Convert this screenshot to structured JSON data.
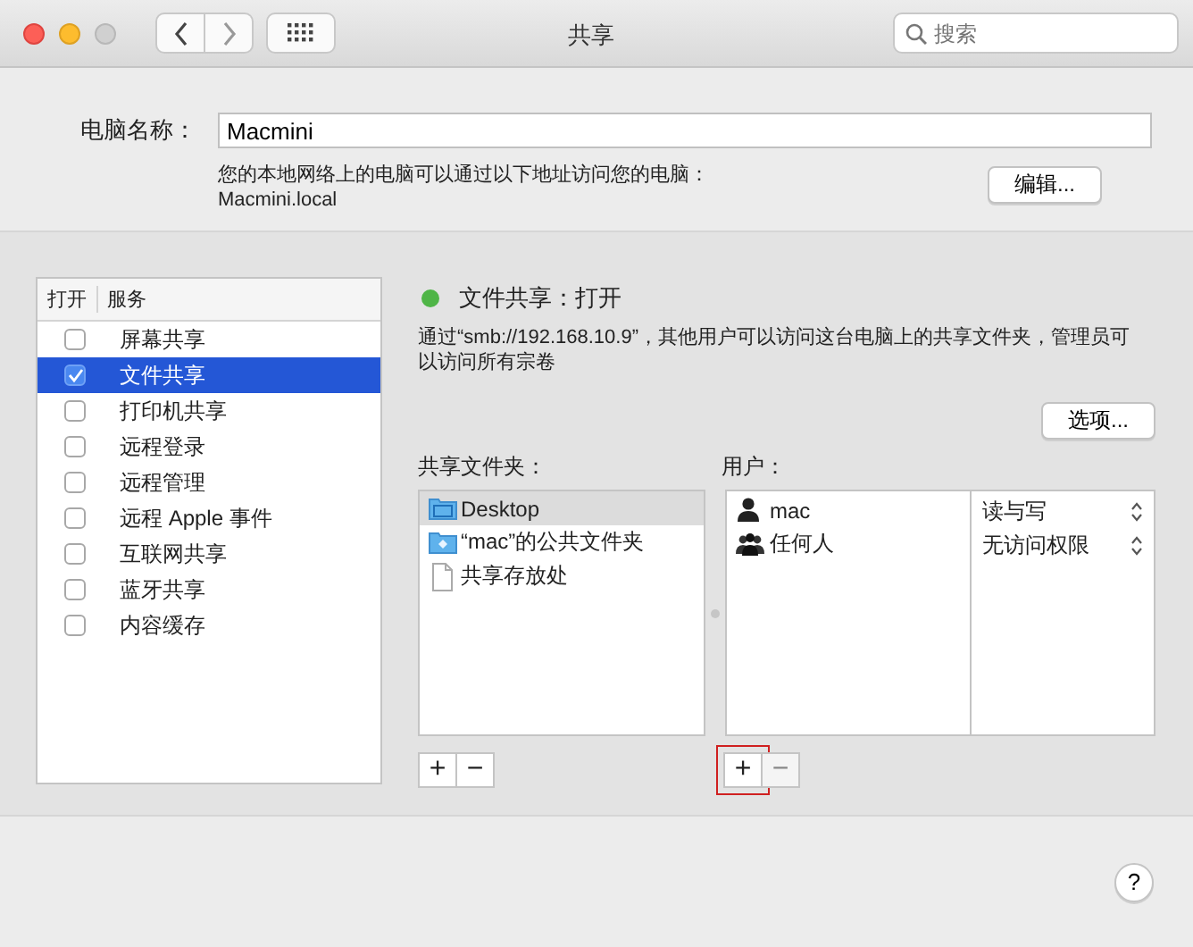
{
  "window": {
    "title": "共享",
    "search": {
      "placeholder": "搜索"
    }
  },
  "computer_name": {
    "label": "电脑名称：",
    "value": "Macmini",
    "hint": "您的本地网络上的电脑可以通过以下地址访问您的电脑：",
    "address": "Macmini.local",
    "edit_button": "编辑..."
  },
  "services": {
    "columns": [
      "打开",
      "服务"
    ],
    "items": [
      {
        "name": "屏幕共享",
        "checked": false,
        "selected": false
      },
      {
        "name": "文件共享",
        "checked": true,
        "selected": true
      },
      {
        "name": "打印机共享",
        "checked": false,
        "selected": false
      },
      {
        "name": "远程登录",
        "checked": false,
        "selected": false
      },
      {
        "name": "远程管理",
        "checked": false,
        "selected": false
      },
      {
        "name": "远程 Apple 事件",
        "checked": false,
        "selected": false
      },
      {
        "name": "互联网共享",
        "checked": false,
        "selected": false
      },
      {
        "name": "蓝牙共享",
        "checked": false,
        "selected": false
      },
      {
        "name": "内容缓存",
        "checked": false,
        "selected": false
      }
    ]
  },
  "status": {
    "text": "文件共享：打开",
    "on": true
  },
  "description": "通过“smb://192.168.10.9”，其他用户可以访问这台电脑上的共享文件夹，管理员可以访问所有宗卷",
  "options_button": "选项...",
  "shared_folders": {
    "label": "共享文件夹：",
    "items": [
      {
        "name": "Desktop",
        "kind": "desktop",
        "selected": true
      },
      {
        "name": "“mac”的公共文件夹",
        "kind": "public",
        "selected": false
      },
      {
        "name": "共享存放处",
        "kind": "document",
        "selected": false
      }
    ],
    "buttons": [
      {
        "label": "+",
        "disabled": false
      },
      {
        "label": "−",
        "disabled": false
      }
    ]
  },
  "users": {
    "label": "用户：",
    "items": [
      {
        "name": "mac",
        "kind": "user",
        "permission": "读与写"
      },
      {
        "name": "任何人",
        "kind": "group",
        "permission": "无访问权限"
      }
    ],
    "buttons": [
      {
        "label": "+",
        "disabled": false,
        "highlighted": true
      },
      {
        "label": "−",
        "disabled": true,
        "highlighted": false
      }
    ]
  },
  "help_button": "?"
}
